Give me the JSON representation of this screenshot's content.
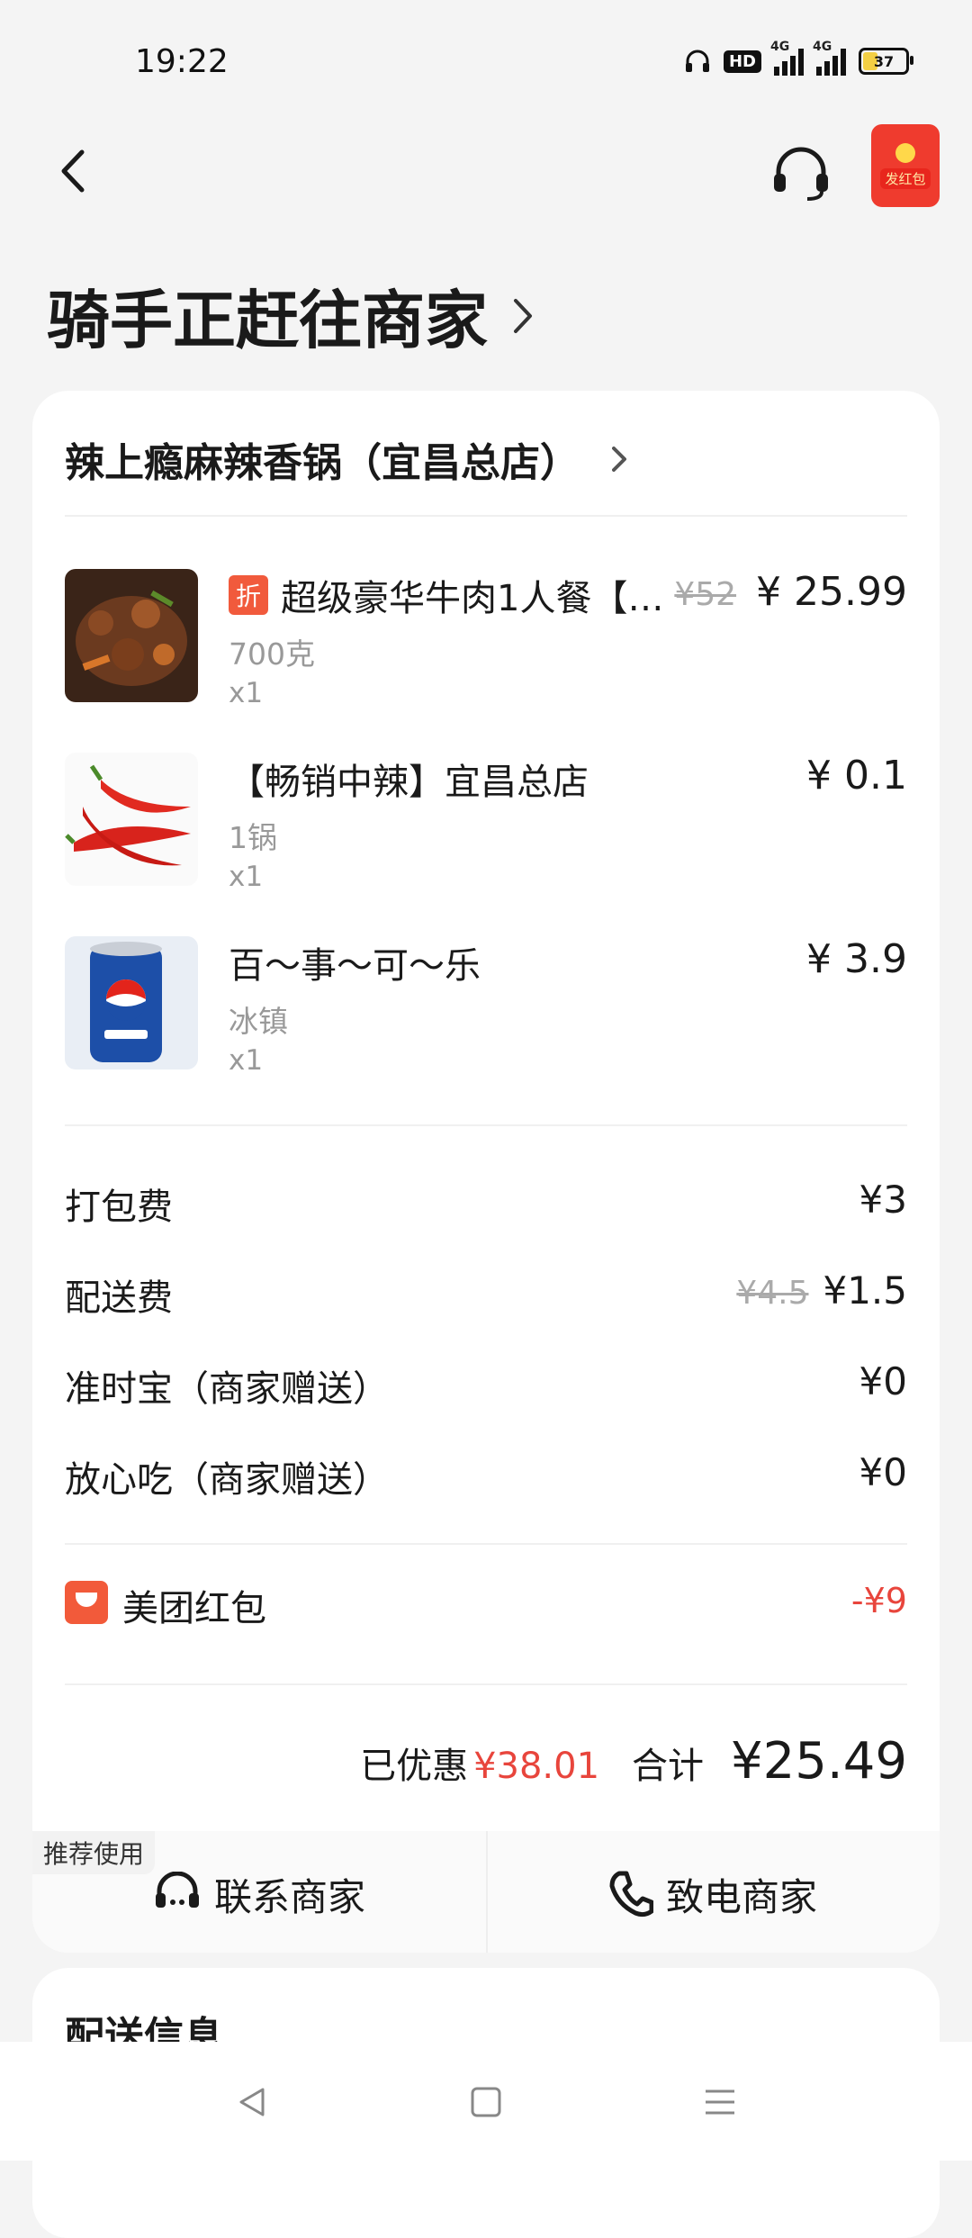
{
  "status_bar": {
    "time": "19:22",
    "hd": "HD",
    "net1": "4G",
    "net2": "4G",
    "battery": "37",
    "battery_level": 0.37
  },
  "header": {
    "status_title": "骑手正赶往商家",
    "redpacket_label": "发红包"
  },
  "store": {
    "name": "辣上瘾麻辣香锅（宜昌总店）"
  },
  "items": [
    {
      "badge": "折",
      "name": "超级豪华牛肉1人餐【…",
      "spec": "700克",
      "qty": "x1",
      "orig_price": "¥52",
      "price": "¥ 25.99",
      "image": "beef-dish"
    },
    {
      "name": "【畅销中辣】宜昌总店",
      "spec": "1锅",
      "qty": "x1",
      "price": "¥ 0.1",
      "image": "red-chili"
    },
    {
      "name": "百～事～可～乐",
      "spec": "冰镇",
      "qty": "x1",
      "price": "¥ 3.9",
      "image": "pepsi-can"
    }
  ],
  "fees": [
    {
      "label": "打包费",
      "value": "¥3"
    },
    {
      "label": "配送费",
      "orig": "¥4.5",
      "value": "¥1.5"
    },
    {
      "label": "准时宝（商家赠送）",
      "value": "¥0"
    },
    {
      "label": "放心吃（商家赠送）",
      "value": "¥0"
    }
  ],
  "coupon": {
    "label": "美团红包",
    "value": "-¥9"
  },
  "summary": {
    "saved_label": "已优惠",
    "saved_value": "¥38.01",
    "total_label": "合计",
    "total_value": "¥25.49"
  },
  "actions": {
    "recommend_tag": "推荐使用",
    "contact": "联系商家",
    "call": "致电商家"
  },
  "delivery_section": {
    "title": "配送信息"
  },
  "colors": {
    "accent_red": "#e8453c",
    "badge_orange": "#f15a3c"
  }
}
